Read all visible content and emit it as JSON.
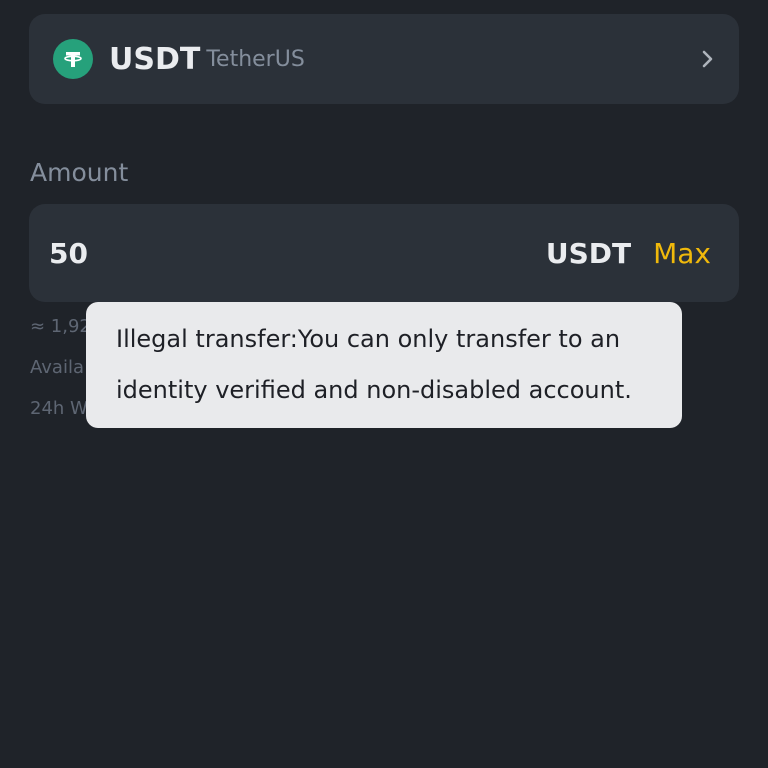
{
  "coin": {
    "symbol": "USDT",
    "name": "TetherUS",
    "logo_icon": "tether-icon",
    "chevron_icon": "chevron-right-icon"
  },
  "amount": {
    "label": "Amount",
    "value": "50",
    "unit": "USDT",
    "max_label": "Max"
  },
  "info": {
    "estimate": "≈ 1,92",
    "available": "Availa",
    "withdraw_limit": "24h W"
  },
  "toast": {
    "line1": "Illegal transfer:You can only transfer to an",
    "line2": "identity verified and non-disabled account."
  },
  "colors": {
    "background": "#1f2329",
    "card": "#2b3139",
    "accent": "#f0b90b",
    "tether": "#26a17b",
    "toast_bg": "#e9eaec"
  }
}
